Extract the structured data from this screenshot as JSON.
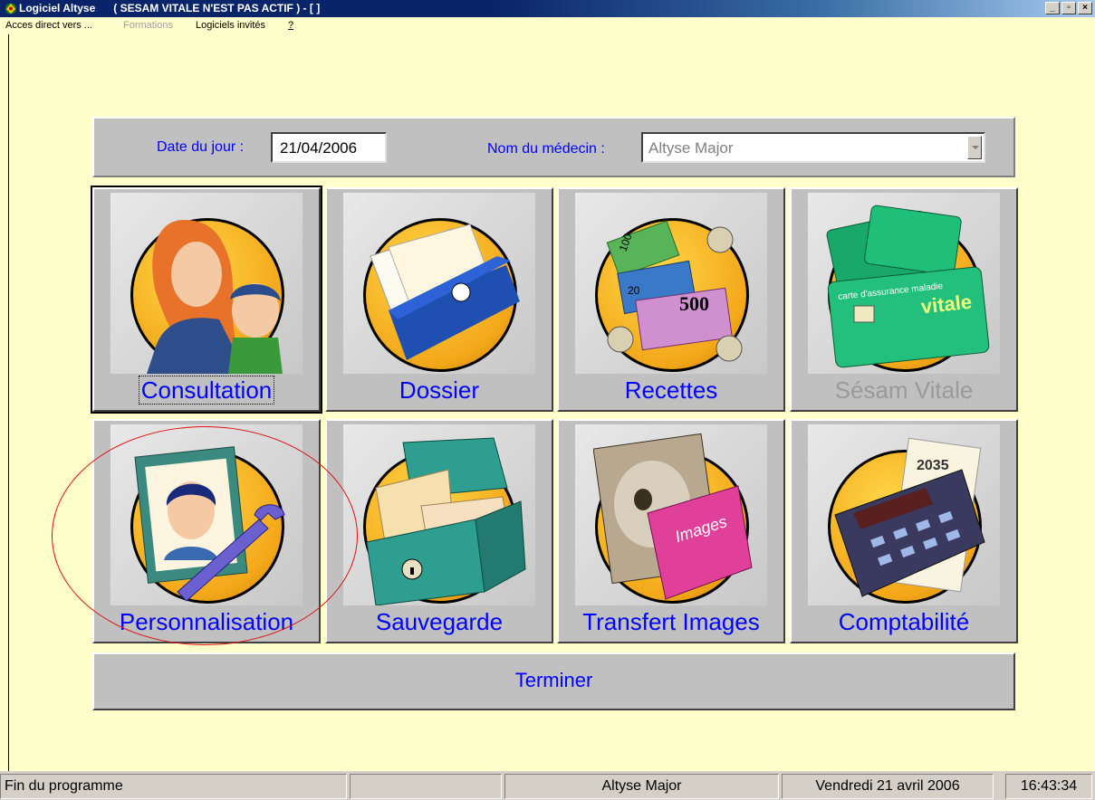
{
  "window": {
    "title": "Logiciel Altyse      ( SESAM VITALE N'EST PAS ACTIF ) - [ ]",
    "controls": [
      "_",
      "▫",
      "×"
    ]
  },
  "menu": {
    "items": [
      {
        "label": "Acces direct vers ..."
      },
      {
        "label": "Formations",
        "disabled": true
      },
      {
        "label": "Logiciels invités"
      },
      {
        "label": "?"
      }
    ]
  },
  "header": {
    "date_label": "Date du jour :",
    "date_value": "21/04/2006",
    "doctor_label": "Nom du médecin :",
    "doctor_value": "Altyse Major"
  },
  "tiles": [
    {
      "label": "Consultation",
      "icon": "family-icon"
    },
    {
      "label": "Dossier",
      "icon": "folder-icon"
    },
    {
      "label": "Recettes",
      "icon": "banknotes-icon"
    },
    {
      "label": "Sésam Vitale",
      "icon": "vitale-card-icon",
      "disabled": true
    },
    {
      "label": "Personnalisation",
      "icon": "portrait-wrench-icon"
    },
    {
      "label": "Sauvegarde",
      "icon": "file-box-icon"
    },
    {
      "label": "Transfert Images",
      "icon": "xray-images-icon"
    },
    {
      "label": "Comptabilité",
      "icon": "calculator-icon"
    }
  ],
  "terminer_label": "Terminer",
  "status": {
    "message": "Fin du programme",
    "empty": "",
    "user": "Altyse Major",
    "date": "Vendredi 21 avril 2006",
    "time": "16:43:34"
  },
  "calc_year": "2035",
  "card_text": "vitale",
  "card_caption": "carte d'assurance maladie",
  "money_500": "500",
  "money_20": "20",
  "money_100": "100",
  "images_text": "Images",
  "colors": {
    "background": "#ffffcc",
    "label": "#0000ff",
    "annotation": "#e01010"
  }
}
